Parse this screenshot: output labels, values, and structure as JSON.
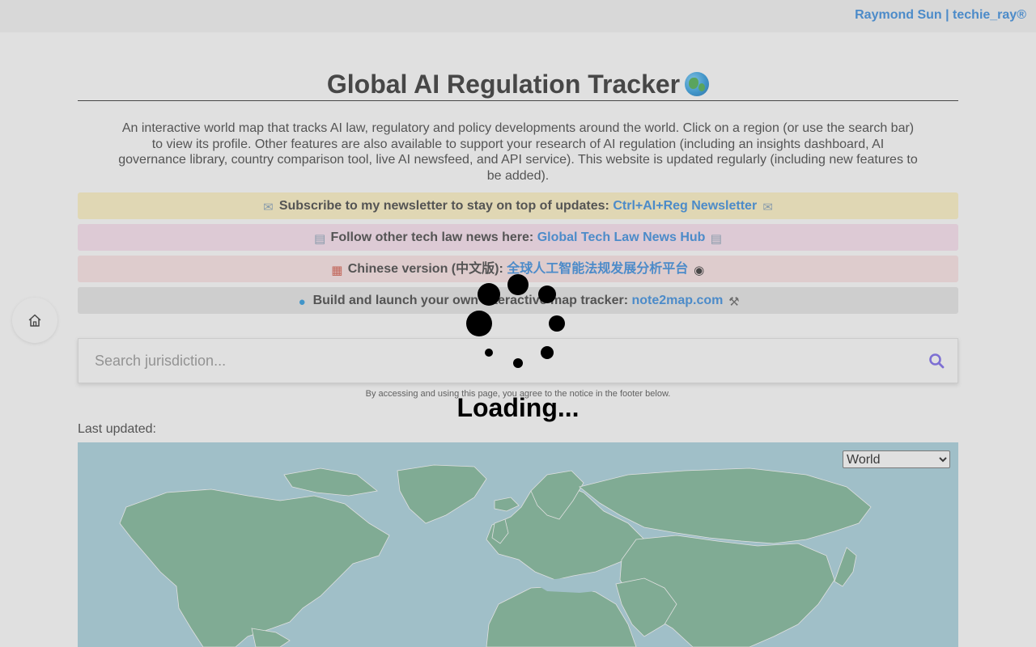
{
  "header": {
    "author_link": "Raymond Sun | techie_ray®"
  },
  "page": {
    "title": "Global AI Regulation Tracker",
    "intro": "An interactive world map that tracks AI law, regulatory and policy developments around the world. Click on a region (or use the search bar) to view its profile. Other features are also available to support your research of AI regulation (including an insights dashboard, AI governance library, country comparison tool, live AI newsfeed, and API service). This website is updated regularly (including new features to be added)."
  },
  "banners": [
    {
      "text": "Subscribe to my newsletter to stay on top of updates: ",
      "link": "Ctrl+AI+Reg Newsletter",
      "color": "#fff3c4"
    },
    {
      "text": "Follow other tech law news here: ",
      "link": "Global Tech Law News Hub",
      "color": "#fbe2f0"
    },
    {
      "text": "Chinese version (中文版): ",
      "link": "全球人工智能法规发展分析平台",
      "color": "#fde4e6"
    },
    {
      "text": "Build and launch your own interactive map tracker: ",
      "link": "note2map.com",
      "color": "#e7e7e7"
    }
  ],
  "search": {
    "placeholder": "Search jurisdiction..."
  },
  "notice": "By accessing and using this page, you agree to the notice in the footer below.",
  "last_updated_label": "Last updated:",
  "map": {
    "region_options": [
      "World"
    ],
    "selected_region": "World",
    "ocean_color": "#aad3df",
    "land_color": "#7fb89a"
  },
  "loading": {
    "text": "Loading..."
  },
  "colors": {
    "link": "#3a8ee0",
    "search_icon": "#7b68ee"
  }
}
